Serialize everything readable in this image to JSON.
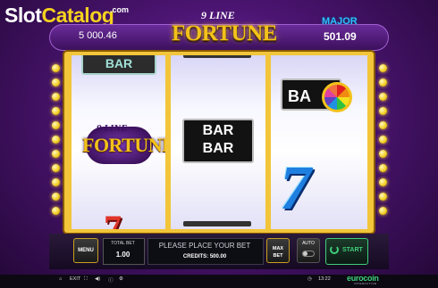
{
  "watermark": {
    "part1": "Slot",
    "part2": "Catalog",
    "suffix": ".com"
  },
  "jackpots": {
    "left_value": "5 000.46",
    "major_label": "MAJOR",
    "major_value": "501.09"
  },
  "logo": {
    "line1": "9 LINE",
    "line2": "FORTUNE"
  },
  "reels": {
    "reel1": {
      "top_symbol": "BAR",
      "middle_logo_line1": "9 LINE",
      "middle_logo_line2": "FORTUNE",
      "bottom_symbol": "7"
    },
    "reel2": {
      "middle_line1": "BAR",
      "middle_line2": "BAR"
    },
    "reel3": {
      "top_symbol": "BA",
      "bottom_symbol": "7"
    }
  },
  "panel": {
    "menu_label": "MENU",
    "total_bet_label": "TOTAL BET",
    "total_bet_value": "1.00",
    "message": "PLEASE PLACE YOUR BET",
    "credits_text": "CREDITS: 500.00",
    "maxbet_line1": "MAX",
    "maxbet_line2": "BET",
    "auto_label": "AUTO",
    "start_label": "START"
  },
  "status_bar": {
    "exit_label": "EXIT",
    "clock": "13:22",
    "brand": "eurocoin",
    "brand_sub": "INTERACTIVE"
  },
  "colors": {
    "accent_gold": "#f3c21a",
    "start_green": "#3fcf7a",
    "major_blue": "#2ec0ff"
  },
  "icons": [
    "home-icon",
    "exit-icon",
    "sound-icon",
    "info-icon",
    "settings-icon",
    "start-refresh-icon"
  ]
}
